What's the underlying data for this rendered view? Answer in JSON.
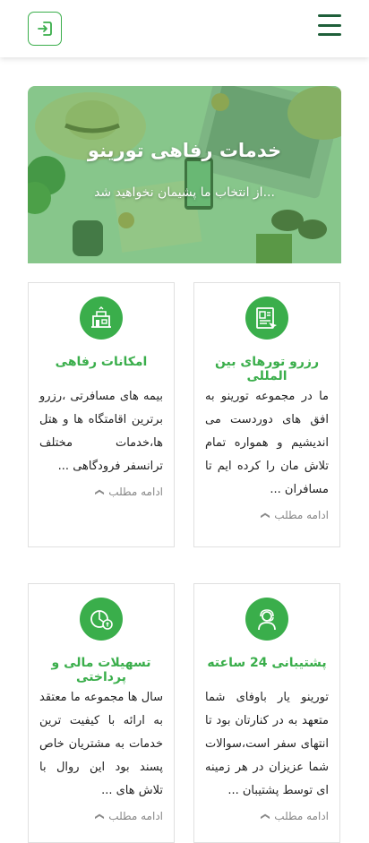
{
  "header": {
    "login_icon": "login-icon",
    "menu_icon": "hamburger-icon"
  },
  "hero": {
    "title": "خدمات رفاهی تورینو",
    "subtitle": "از انتخاب ما پشیمان نخواهید شد..."
  },
  "cards": [
    {
      "icon": "booking-icon",
      "title": "رزرو تورهای بین المللی",
      "text": "ما در مجموعه تورینو به افق های دوردست می اندیشیم و همواره تمام تلاش مان را کرده ایم تا مسافران ...",
      "more": "ادامه مطلب"
    },
    {
      "icon": "welfare-icon",
      "title": "امکانات رفاهی",
      "text": "بیمه های مسافرتی ،رزرو برترین اقامتگاه ها و هتل ها،خدمات مختلف ترانسفر فرودگاهی ...",
      "more": "ادامه مطلب"
    },
    {
      "icon": "support-agent-icon",
      "title": "پشتیبانی 24 ساعته",
      "text": "تورینو یار باوفای شما متعهد به در کنارتان بود تا انتهای سفر است،سوالات شما عزیزان در هر زمینه ای توسط پشتیبان ...",
      "more": "ادامه مطلب"
    },
    {
      "icon": "payment-icon",
      "title": "تسهیلات مالی و پرداختی",
      "text": "سال ها مجموعه ما معتقد به ارائه با کیفیت ترین خدمات به مشتریان خاص پسند بود این روال با تلاش های ...",
      "more": "ادامه مطلب"
    }
  ],
  "colors": {
    "accent": "#3aae4b",
    "menu": "#1f5f3a"
  }
}
